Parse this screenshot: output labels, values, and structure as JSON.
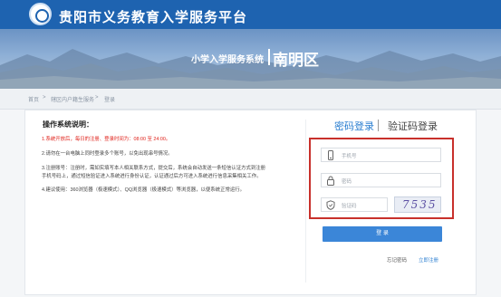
{
  "header": {
    "title": "贵阳市义务教育入学服务平台"
  },
  "banner": {
    "subtitle": "小学入学服务系统",
    "district": "南明区"
  },
  "breadcrumb": [
    "首页",
    ">",
    "辖区内户籍生服务",
    ">",
    "登录"
  ],
  "notes": {
    "title": "操作系统说明：",
    "items": [
      "1.系统开放后，每日的注册、登录时间为：08:00 至 24:00。",
      "2.请勿在一台电脑上同时登录多个账号，以免出现串号情况。",
      "3.注册账号：注册时，需如实填写本人相关联系方式，提交后，系统会自动发送一条短信认证方式到注册",
      "手机号码上，通过短信验证进入系统进行身份认证，认证通过后方可进入系统进行信息采集相关工作。",
      "4.建议使用：360浏览器（极速模式）、QQ浏览器（极速模式）等浏览器，以便系统正常运行。"
    ]
  },
  "login": {
    "tab_password": "密码登录",
    "tab_code": "验证码登录",
    "phone_placeholder": "手机号",
    "password_placeholder": "密码",
    "captcha_placeholder": "验证码",
    "captcha_text": "7535",
    "submit": "登 录",
    "forgot": "忘记密码",
    "register": "立即注册"
  },
  "colors": {
    "header_bg": "#1e63b0",
    "accent": "#3b86d8",
    "highlight_border": "#c8302b",
    "warning_text": "#e0231c"
  },
  "icons": {
    "logo": "school-emblem-icon",
    "phone": "phone-icon",
    "lock": "lock-icon",
    "shield": "shield-icon"
  }
}
